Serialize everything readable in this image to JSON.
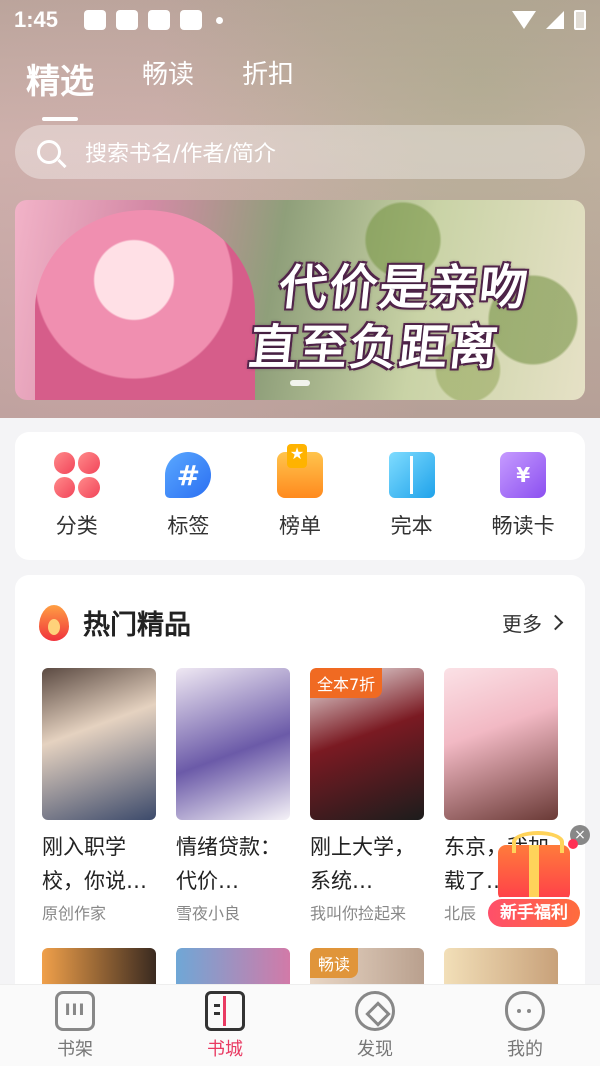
{
  "status": {
    "time": "1:45"
  },
  "top_tabs": [
    {
      "label": "精选",
      "active": true
    },
    {
      "label": "畅读",
      "active": false
    },
    {
      "label": "折扣",
      "active": false
    }
  ],
  "search": {
    "placeholder": "搜索书名/作者/简介"
  },
  "banner": {
    "line1": "代价是亲吻",
    "line2": "直至负距离"
  },
  "quick_links": [
    {
      "label": "分类",
      "icon": "category-icon"
    },
    {
      "label": "标签",
      "icon": "tag-icon"
    },
    {
      "label": "榜单",
      "icon": "ranking-icon"
    },
    {
      "label": "完本",
      "icon": "completed-book-icon"
    },
    {
      "label": "畅读卡",
      "icon": "reading-card-icon"
    }
  ],
  "hot_section": {
    "title": "热门精品",
    "more_label": "更多",
    "books": [
      {
        "title": "刚入职学校，你说…",
        "author": "原创作家",
        "badge": ""
      },
      {
        "title": "情绪贷款：代价…",
        "author": "雪夜小良",
        "badge": ""
      },
      {
        "title": "刚上大学，系统…",
        "author": "我叫你捡起来",
        "badge": "全本7折"
      },
      {
        "title": "东京，我加载了…",
        "author": "北辰",
        "badge": ""
      }
    ],
    "next_row_badges": [
      "",
      "",
      "畅读",
      ""
    ]
  },
  "gift": {
    "label": "新手福利",
    "close": "×"
  },
  "bottom_nav": [
    {
      "label": "书架",
      "active": false
    },
    {
      "label": "书城",
      "active": true
    },
    {
      "label": "发现",
      "active": false
    },
    {
      "label": "我的",
      "active": false
    }
  ],
  "colors": {
    "accent": "#e93a62",
    "badge_orange": "#f06a22"
  }
}
